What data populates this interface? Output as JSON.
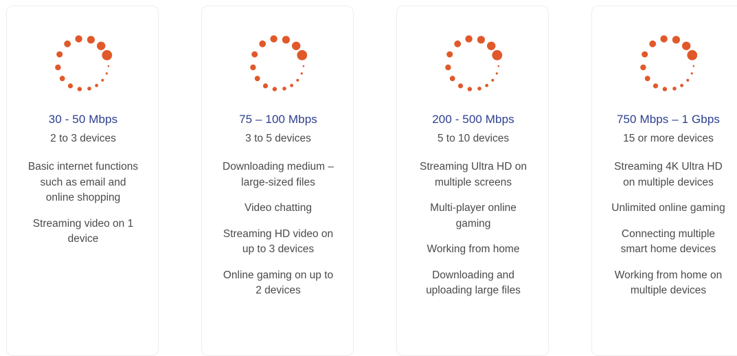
{
  "accent_color": "#e0592a",
  "spinner_icon": "loading-spinner-icon",
  "plans": [
    {
      "speed": "30 - 50 Mbps",
      "devices": "2 to 3 devices",
      "features": [
        "Basic internet functions such as email and online shopping",
        "Streaming video on 1 device"
      ]
    },
    {
      "speed": "75 – 100 Mbps",
      "devices": "3 to 5 devices",
      "features": [
        "Downloading medium – large-sized files",
        "Video chatting",
        "Streaming HD video on up to 3 devices",
        "Online gaming on up to 2 devices"
      ]
    },
    {
      "speed": "200 - 500 Mbps",
      "devices": "5 to 10 devices",
      "features": [
        "Streaming Ultra HD on multiple screens",
        "Multi-player online gaming",
        "Working from home",
        "Downloading and uploading large files"
      ]
    },
    {
      "speed": "750 Mbps – 1 Gbps",
      "devices": "15 or more devices",
      "features": [
        "Streaming 4K Ultra HD on multiple devices",
        "Unlimited online gaming",
        "Connecting multiple smart home devices",
        "Working from home on multiple devices"
      ]
    }
  ]
}
